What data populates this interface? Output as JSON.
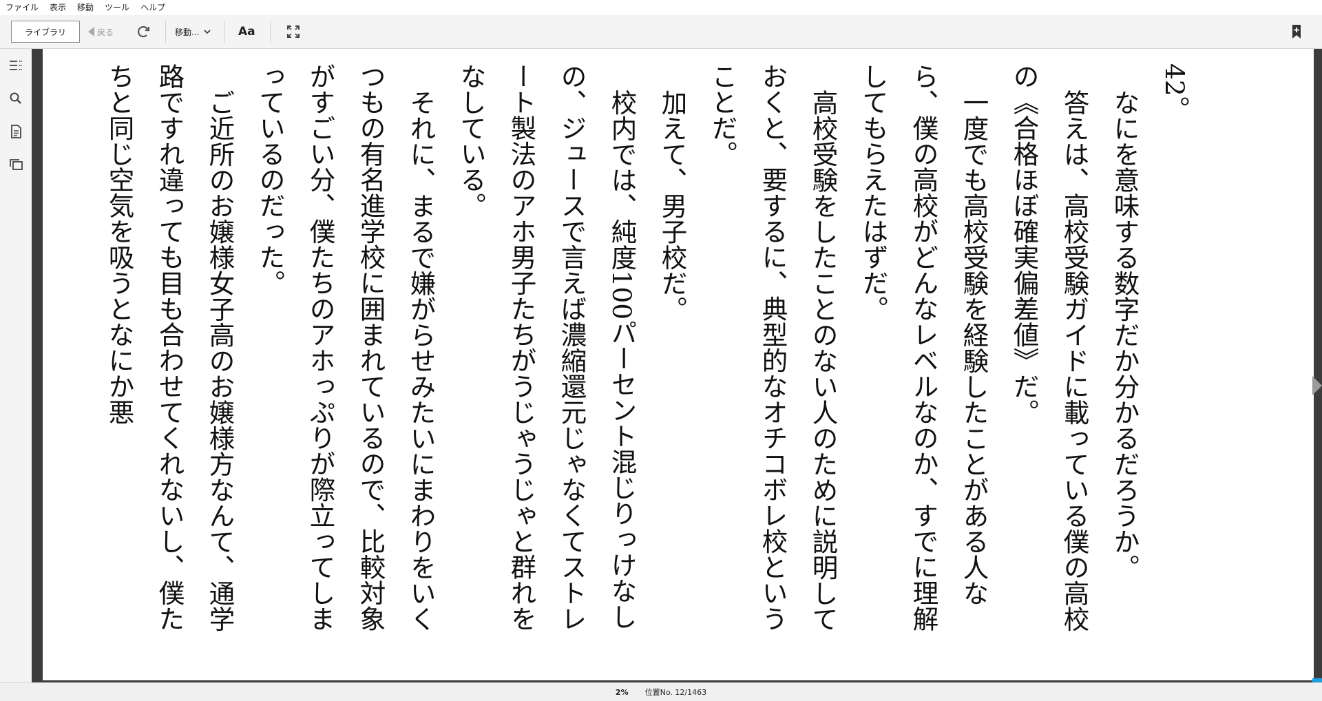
{
  "menu": [
    "ファイル",
    "表示",
    "移動",
    "ツール",
    "ヘルプ"
  ],
  "toolbar": {
    "library_label": "ライブラリ",
    "back_label": "戻る",
    "goto_label": "移動...",
    "font_label": "Aa"
  },
  "icons": {
    "refresh": "refresh-icon",
    "chevron": "chevron-down-icon",
    "fullscreen": "fullscreen-icon",
    "bookmark": "bookmark-add-icon",
    "toc": "table-of-contents-icon",
    "search": "search-icon",
    "notes": "notes-icon",
    "flashcards": "flashcards-icon"
  },
  "content": {
    "chapter_number": "42。",
    "paragraphs": [
      "なにを意味する数字だか分かるだろうか。",
      "答えは、高校受験ガイドに載っている僕の高校の《合格ほぼ確実偏差値》だ。",
      "一度でも高校受験を経験したことがある人なら、僕の高校がどんなレベルなのか、すでに理解してもらえたはずだ。",
      "高校受験をしたことのない人のために説明しておくと、要するに、典型的なオチコボレ校ということだ。",
      "加えて、男子校だ。",
      "校内では、純度100パーセント混じりっけなしの、ジュースで言えば濃縮還元じゃなくてストレート製法のアホ男子たちがうじゃうじゃと群れをなしている。",
      "それに、まるで嫌がらせみたいにまわりをいくつもの有名進学校に囲まれているので、比較対象がすごい分、僕たちのアホっぷりが際立ってしまっているのだった。",
      "ご近所のお嬢様女子高のお嬢様方なんて、通学路ですれ違っても目も合わせてくれないし、僕たちと同じ空気を吸うとなにか悪"
    ]
  },
  "status": {
    "percent": "2%",
    "location": "位置No. 12/1463"
  },
  "colors": {
    "accent": "#1ba1e2",
    "frame": "#3c3c3c"
  }
}
